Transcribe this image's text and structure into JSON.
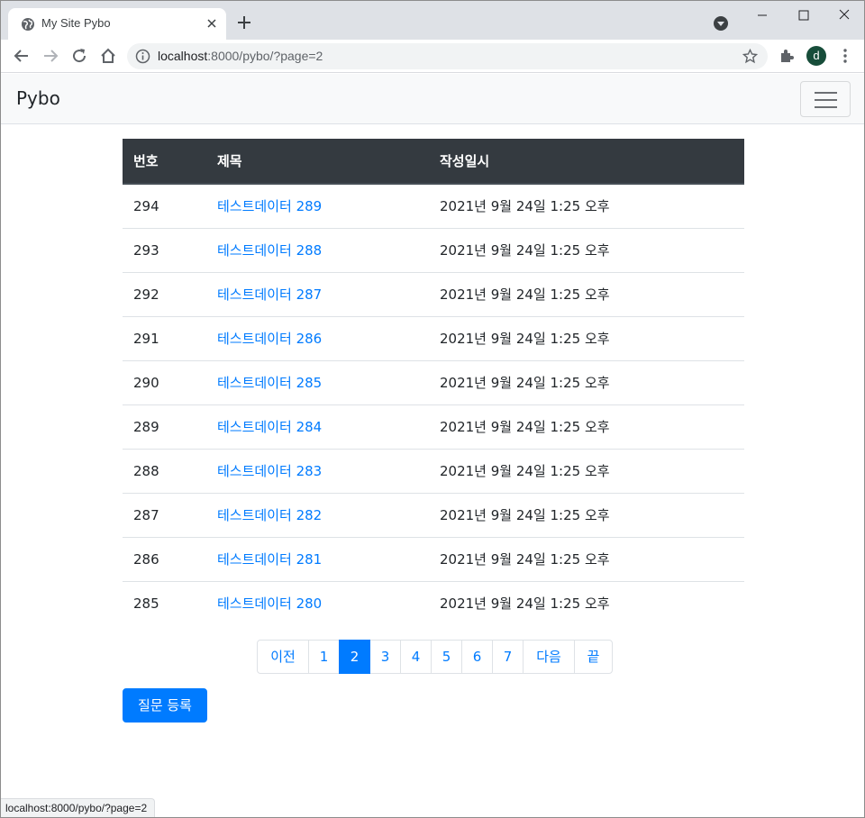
{
  "browser": {
    "tab_title": "My Site Pybo",
    "url_host": "localhost",
    "url_rest": ":8000/pybo/?page=2",
    "avatar_initial": "d",
    "status_url": "localhost:8000/pybo/?page=2"
  },
  "navbar": {
    "brand": "Pybo"
  },
  "table": {
    "headers": [
      "번호",
      "제목",
      "작성일시"
    ],
    "rows": [
      {
        "no": "294",
        "subject": "테스트데이터 289",
        "date": "2021년 9월 24일 1:25 오후"
      },
      {
        "no": "293",
        "subject": "테스트데이터 288",
        "date": "2021년 9월 24일 1:25 오후"
      },
      {
        "no": "292",
        "subject": "테스트데이터 287",
        "date": "2021년 9월 24일 1:25 오후"
      },
      {
        "no": "291",
        "subject": "테스트데이터 286",
        "date": "2021년 9월 24일 1:25 오후"
      },
      {
        "no": "290",
        "subject": "테스트데이터 285",
        "date": "2021년 9월 24일 1:25 오후"
      },
      {
        "no": "289",
        "subject": "테스트데이터 284",
        "date": "2021년 9월 24일 1:25 오후"
      },
      {
        "no": "288",
        "subject": "테스트데이터 283",
        "date": "2021년 9월 24일 1:25 오후"
      },
      {
        "no": "287",
        "subject": "테스트데이터 282",
        "date": "2021년 9월 24일 1:25 오후"
      },
      {
        "no": "286",
        "subject": "테스트데이터 281",
        "date": "2021년 9월 24일 1:25 오후"
      },
      {
        "no": "285",
        "subject": "테스트데이터 280",
        "date": "2021년 9월 24일 1:25 오후"
      }
    ]
  },
  "pagination": {
    "prev": "이전",
    "pages": [
      "1",
      "2",
      "3",
      "4",
      "5",
      "6",
      "7"
    ],
    "current_page": "2",
    "next": "다음",
    "end": "끝"
  },
  "actions": {
    "create_question": "질문 등록"
  },
  "colors": {
    "primary": "#007bff",
    "table_header_bg": "#343a40",
    "navbar_bg": "#f8f9fa",
    "tabstrip_bg": "#dee1e6"
  }
}
